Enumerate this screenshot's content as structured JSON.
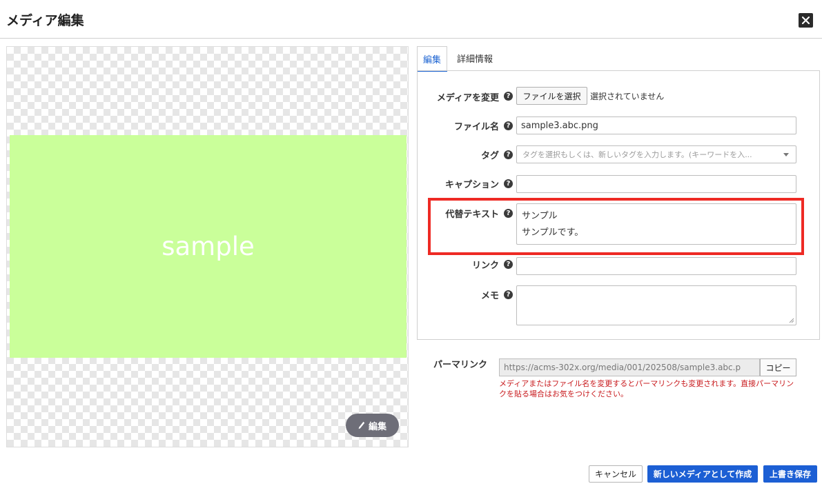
{
  "header": {
    "title": "メディア編集",
    "close_icon": "close-icon"
  },
  "preview": {
    "image_text": "sample",
    "image_color": "#caff9a",
    "edit_label": "編集",
    "edit_icon": "pencil-icon"
  },
  "tabs": [
    {
      "label": "編集",
      "active": true
    },
    {
      "label": "詳細情報",
      "active": false
    }
  ],
  "form": {
    "media_change": {
      "label": "メディアを変更",
      "button_label": "ファイルを選択",
      "status": "選択されていません"
    },
    "file_name": {
      "label": "ファイル名",
      "value": "sample3.abc.png"
    },
    "tag": {
      "label": "タグ",
      "placeholder": "タグを選択もしくは、新しいタグを入力します。(キーワードを入..."
    },
    "caption": {
      "label": "キャプション",
      "value": ""
    },
    "alt_text": {
      "label": "代替テキスト",
      "line1": "サンプル",
      "line2": "サンプルです。"
    },
    "link": {
      "label": "リンク",
      "value": ""
    },
    "memo": {
      "label": "メモ",
      "value": ""
    },
    "help_glyph": "?"
  },
  "permalink": {
    "label": "パーマリンク",
    "value": "https://acms-302x.org/media/001/202508/sample3.abc.p",
    "copy_label": "コピー",
    "note": "メディアまたはファイル名を変更するとパーマリンクも変更されます。直接パーマリンクを貼る場合はお気をつけください。"
  },
  "footer": {
    "cancel_label": "キャンセル",
    "new_label": "新しいメディアとして作成",
    "overwrite_label": "上書き保存"
  },
  "colors": {
    "accent": "#1c5fd4",
    "highlight": "#ee2a24",
    "warning_text": "#c8191c"
  }
}
